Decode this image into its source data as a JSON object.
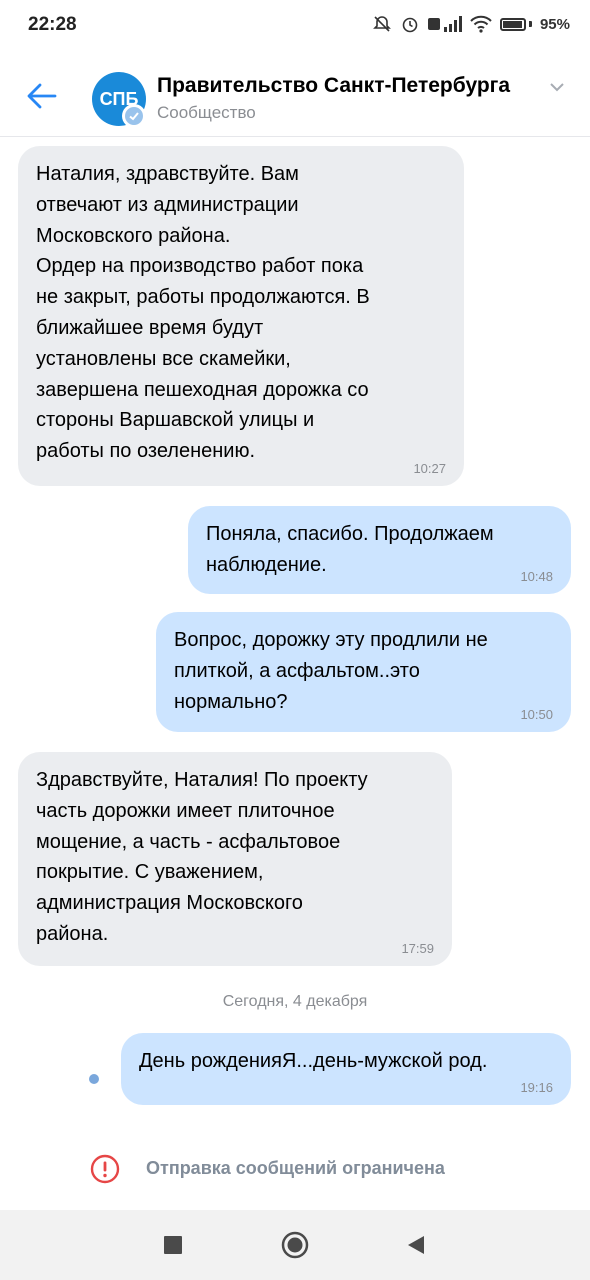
{
  "status_bar": {
    "time": "22:28",
    "battery": "95%",
    "battery_level": 0.95
  },
  "header": {
    "back_icon": "arrow-left-icon",
    "avatar_text": "СПБ",
    "title": "Правительство Санкт-Петербурга",
    "subtitle": "Сообщество"
  },
  "messages": [
    {
      "direction": "in",
      "text": "Наталия, здравствуйте. Вам\nотвечают из администрации\nМосковского района.\nОрдер на производство работ пока\nне закрыт, работы продолжаются. В\nближайшее время будут\nустановлены все скамейки,\nзавершена пешеходная дорожка со\nстороны Варшавской улицы и\nработы по озеленению.",
      "time": "10:27"
    },
    {
      "direction": "out",
      "text": "Поняла, спасибо. Продолжаем\nнаблюдение.",
      "time": "10:48"
    },
    {
      "direction": "out",
      "text": "Вопрос, дорожку эту продлили не\nплиткой, а асфальтом..это\nнормально?",
      "time": "10:50"
    },
    {
      "direction": "in",
      "text": "Здравствуйте, Наталия! По проекту\nчасть дорожки имеет плиточное\nмощение, а часть - асфальтовое\nпокрытие. С уважением,\nадминистрация Московского\nрайона.",
      "time": "17:59"
    },
    {
      "direction": "out",
      "text": "День рожденияЯ...день-мужской род.",
      "time": "19:16"
    }
  ],
  "date_separator": "Сегодня, 4 декабря",
  "restricted_notice": "Отправка сообщений ограничена",
  "colors": {
    "accent": "#2787f5",
    "incoming_bubble": "#ebedf0",
    "outgoing_bubble": "#cce4ff",
    "warning": "#e64646"
  }
}
